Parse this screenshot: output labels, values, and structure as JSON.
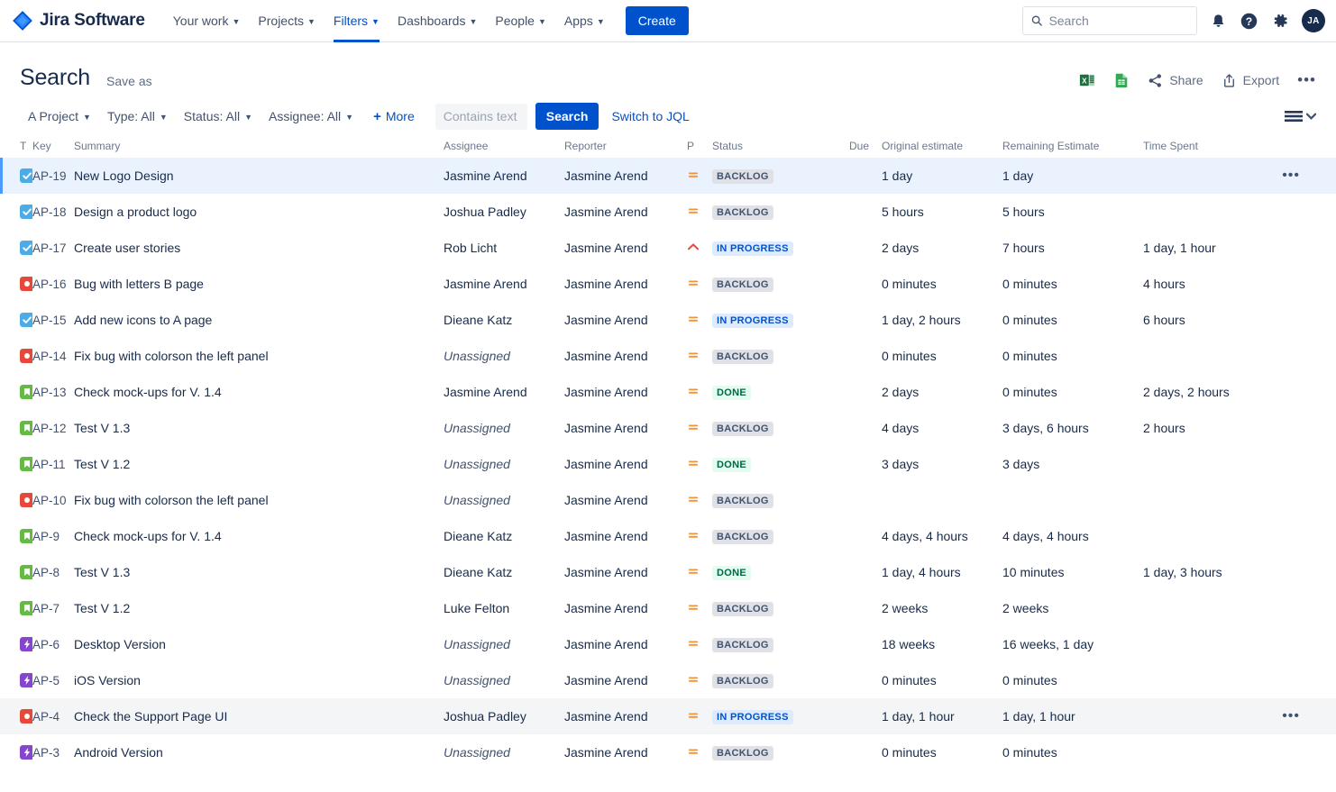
{
  "nav": {
    "brand": "Jira Software",
    "items": [
      {
        "label": "Your work",
        "caret": true,
        "active": false
      },
      {
        "label": "Projects",
        "caret": true,
        "active": false
      },
      {
        "label": "Filters",
        "caret": true,
        "active": true
      },
      {
        "label": "Dashboards",
        "caret": true,
        "active": false
      },
      {
        "label": "People",
        "caret": true,
        "active": false
      },
      {
        "label": "Apps",
        "caret": true,
        "active": false
      }
    ],
    "create_label": "Create",
    "search_placeholder": "Search",
    "search_value": "",
    "icons": [
      "notifications-bell-icon",
      "help-icon",
      "settings-gear-icon"
    ],
    "avatar_initials": "JA"
  },
  "header": {
    "title": "Search",
    "save_as": "Save as",
    "export_excel_label": "Export Excel",
    "export_sheets_label": "Export Google Sheets",
    "share_label": "Share",
    "export_label": "Export",
    "more_label": "More actions"
  },
  "filters": {
    "project": "A Project",
    "type": "Type: All",
    "status": "Status: All",
    "assignee": "Assignee: All",
    "more": "More",
    "text_placeholder": "Contains text",
    "text_value": "",
    "search_button": "Search",
    "switch_jql": "Switch to JQL",
    "view_toggle": "list-view-toggle"
  },
  "table": {
    "columns": {
      "t": "T",
      "key": "Key",
      "summary": "Summary",
      "assignee": "Assignee",
      "reporter": "Reporter",
      "p": "P",
      "status": "Status",
      "due": "Due",
      "original_estimate": "Original estimate",
      "remaining_estimate": "Remaining Estimate",
      "time_spent": "Time Spent"
    },
    "colors": {
      "task": "#4bade8",
      "bug": "#e5493a",
      "story": "#65ba43",
      "epic": "#8545cf",
      "priority_medium": "#f79232",
      "priority_high": "#e5493a",
      "accent": "#0052cc"
    },
    "rows": [
      {
        "type": "task",
        "key": "AP-19",
        "summary": "New Logo Design",
        "assignee": "Jasmine Arend",
        "reporter": "Jasmine Arend",
        "priority": "medium",
        "status": "BACKLOG",
        "due": "",
        "original": "1 day",
        "remaining": "1 day",
        "spent": "",
        "selected": true,
        "hover": false,
        "dots": true
      },
      {
        "type": "task",
        "key": "AP-18",
        "summary": "Design a product logo",
        "assignee": "Joshua Padley",
        "reporter": "Jasmine Arend",
        "priority": "medium",
        "status": "BACKLOG",
        "due": "",
        "original": "5 hours",
        "remaining": "5 hours",
        "spent": "",
        "selected": false,
        "hover": false,
        "dots": false
      },
      {
        "type": "task",
        "key": "AP-17",
        "summary": "Create user stories",
        "assignee": "Rob Licht",
        "reporter": "Jasmine Arend",
        "priority": "high",
        "status": "IN PROGRESS",
        "due": "",
        "original": "2 days",
        "remaining": "7 hours",
        "spent": "1 day, 1 hour",
        "selected": false,
        "hover": false,
        "dots": false
      },
      {
        "type": "bug",
        "key": "AP-16",
        "summary": "Bug with letters B page",
        "assignee": "Jasmine Arend",
        "reporter": "Jasmine Arend",
        "priority": "medium",
        "status": "BACKLOG",
        "due": "",
        "original": "0 minutes",
        "remaining": "0 minutes",
        "spent": "4 hours",
        "selected": false,
        "hover": false,
        "dots": false
      },
      {
        "type": "task",
        "key": "AP-15",
        "summary": "Add new icons to A page",
        "assignee": "Dieane Katz",
        "reporter": "Jasmine Arend",
        "priority": "medium",
        "status": "IN PROGRESS",
        "due": "",
        "original": "1 day, 2 hours",
        "remaining": "0 minutes",
        "spent": "6 hours",
        "selected": false,
        "hover": false,
        "dots": false
      },
      {
        "type": "bug",
        "key": "AP-14",
        "summary": "Fix bug with colorson the left panel",
        "assignee": "Unassigned",
        "reporter": "Jasmine Arend",
        "priority": "medium",
        "status": "BACKLOG",
        "due": "",
        "original": "0 minutes",
        "remaining": "0 minutes",
        "spent": "",
        "selected": false,
        "hover": false,
        "dots": false
      },
      {
        "type": "story",
        "key": "AP-13",
        "summary": "Check mock-ups for V. 1.4",
        "assignee": "Jasmine Arend",
        "reporter": "Jasmine Arend",
        "priority": "medium",
        "status": "DONE",
        "due": "",
        "original": "2 days",
        "remaining": "0 minutes",
        "spent": "2 days, 2 hours",
        "selected": false,
        "hover": false,
        "dots": false
      },
      {
        "type": "story",
        "key": "AP-12",
        "summary": "Test V 1.3",
        "assignee": "Unassigned",
        "reporter": "Jasmine Arend",
        "priority": "medium",
        "status": "BACKLOG",
        "due": "",
        "original": "4 days",
        "remaining": "3 days, 6 hours",
        "spent": "2 hours",
        "selected": false,
        "hover": false,
        "dots": false
      },
      {
        "type": "story",
        "key": "AP-11",
        "summary": "Test V 1.2",
        "assignee": "Unassigned",
        "reporter": "Jasmine Arend",
        "priority": "medium",
        "status": "DONE",
        "due": "",
        "original": "3 days",
        "remaining": "3 days",
        "spent": "",
        "selected": false,
        "hover": false,
        "dots": false
      },
      {
        "type": "bug",
        "key": "AP-10",
        "summary": "Fix bug with colorson the left panel",
        "assignee": "Unassigned",
        "reporter": "Jasmine Arend",
        "priority": "medium",
        "status": "BACKLOG",
        "due": "",
        "original": "",
        "remaining": "",
        "spent": "",
        "selected": false,
        "hover": false,
        "dots": false
      },
      {
        "type": "story",
        "key": "AP-9",
        "summary": "Check mock-ups for V. 1.4",
        "assignee": "Dieane Katz",
        "reporter": "Jasmine Arend",
        "priority": "medium",
        "status": "BACKLOG",
        "due": "",
        "original": "4 days, 4 hours",
        "remaining": "4 days, 4 hours",
        "spent": "",
        "selected": false,
        "hover": false,
        "dots": false
      },
      {
        "type": "story",
        "key": "AP-8",
        "summary": "Test V 1.3",
        "assignee": "Dieane Katz",
        "reporter": "Jasmine Arend",
        "priority": "medium",
        "status": "DONE",
        "due": "",
        "original": "1 day, 4 hours",
        "remaining": "10 minutes",
        "spent": "1 day, 3 hours",
        "selected": false,
        "hover": false,
        "dots": false
      },
      {
        "type": "story",
        "key": "AP-7",
        "summary": "Test V 1.2",
        "assignee": "Luke Felton",
        "reporter": "Jasmine Arend",
        "priority": "medium",
        "status": "BACKLOG",
        "due": "",
        "original": "2 weeks",
        "remaining": "2 weeks",
        "spent": "",
        "selected": false,
        "hover": false,
        "dots": false
      },
      {
        "type": "epic",
        "key": "AP-6",
        "summary": "Desktop Version",
        "assignee": "Unassigned",
        "reporter": "Jasmine Arend",
        "priority": "medium",
        "status": "BACKLOG",
        "due": "",
        "original": "18 weeks",
        "remaining": "16 weeks, 1 day",
        "spent": "",
        "selected": false,
        "hover": false,
        "dots": false
      },
      {
        "type": "epic",
        "key": "AP-5",
        "summary": "iOS Version",
        "assignee": "Unassigned",
        "reporter": "Jasmine Arend",
        "priority": "medium",
        "status": "BACKLOG",
        "due": "",
        "original": "0 minutes",
        "remaining": "0 minutes",
        "spent": "",
        "selected": false,
        "hover": false,
        "dots": false
      },
      {
        "type": "bug",
        "key": "AP-4",
        "summary": "Check the Support Page UI",
        "assignee": "Joshua Padley",
        "reporter": "Jasmine Arend",
        "priority": "medium",
        "status": "IN PROGRESS",
        "due": "",
        "original": "1 day, 1 hour",
        "remaining": "1 day, 1 hour",
        "spent": "",
        "selected": false,
        "hover": true,
        "dots": true
      },
      {
        "type": "epic",
        "key": "AP-3",
        "summary": "Android Version",
        "assignee": "Unassigned",
        "reporter": "Jasmine Arend",
        "priority": "medium",
        "status": "BACKLOG",
        "due": "",
        "original": "0 minutes",
        "remaining": "0 minutes",
        "spent": "",
        "selected": false,
        "hover": false,
        "dots": false
      }
    ]
  }
}
